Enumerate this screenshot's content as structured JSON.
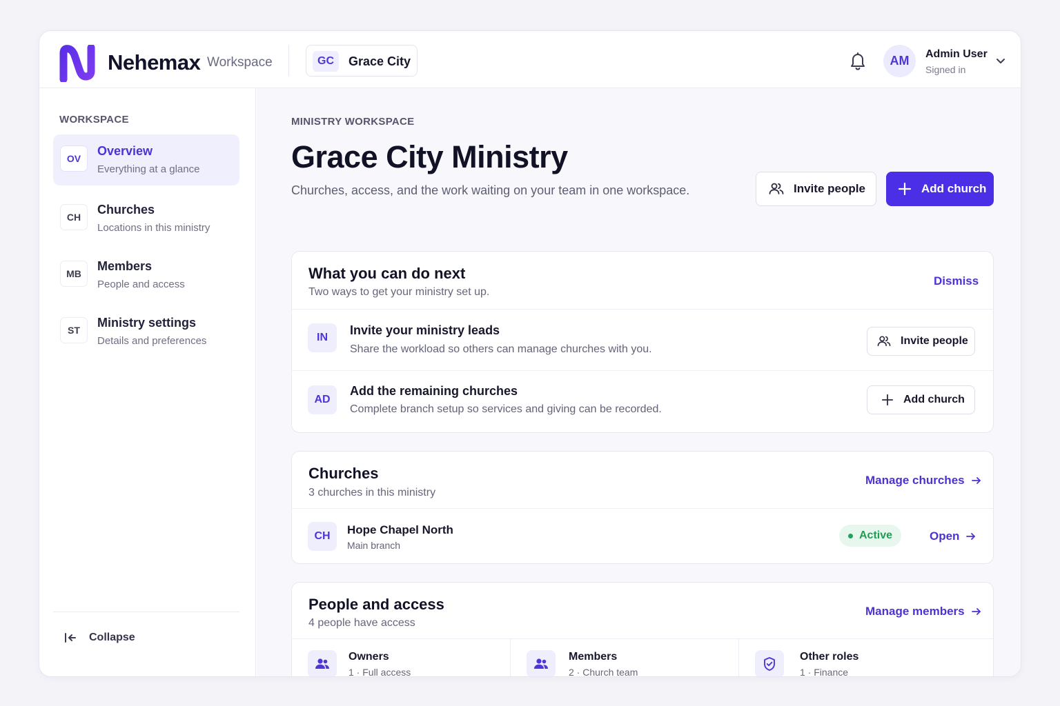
{
  "header": {
    "brand": "Nehemax",
    "brand_sub": "Workspace",
    "church_switcher": {
      "initials": "GC",
      "name": "Grace City"
    },
    "user": {
      "initials": "AM",
      "name": "Admin User",
      "status": "Signed in"
    }
  },
  "sidebar": {
    "heading": "WORKSPACE",
    "items": [
      {
        "code": "OV",
        "title": "Overview",
        "subtitle": "Everything at a glance",
        "active": true
      },
      {
        "code": "CH",
        "title": "Churches",
        "subtitle": "Locations in this ministry"
      },
      {
        "code": "MB",
        "title": "Members",
        "subtitle": "People and access"
      },
      {
        "code": "ST",
        "title": "Ministry settings",
        "subtitle": "Details and preferences"
      }
    ],
    "collapse_label": "Collapse"
  },
  "main": {
    "eyebrow": "MINISTRY WORKSPACE",
    "title": "Grace City Ministry",
    "subtitle": "Churches, access, and the work waiting on your team in one workspace.",
    "invite_label": "Invite people",
    "add_church_label": "Add church",
    "next_steps": {
      "title": "What you can do next",
      "subtitle": "Two ways to get your ministry set up.",
      "dismiss": "Dismiss",
      "items": [
        {
          "code": "IN",
          "title": "Invite your ministry leads",
          "subtitle": "Share the workload so others can manage churches with you.",
          "action": "Invite people"
        },
        {
          "code": "AD",
          "title": "Add the remaining churches",
          "subtitle": "Complete branch setup so services and giving can be recorded.",
          "action": "Add church"
        }
      ]
    },
    "churches": {
      "title": "Churches",
      "subtitle": "3 churches in this ministry",
      "manage": "Manage churches",
      "rows": [
        {
          "code": "CH",
          "name": "Hope Chapel North",
          "detail": "Main branch",
          "status": "Active",
          "open": "Open"
        }
      ]
    },
    "people": {
      "title": "People and access",
      "subtitle": "4 people have access",
      "manage": "Manage members",
      "groups": [
        {
          "title": "Owners",
          "detail": "1 · Full access",
          "icon": "users-icon"
        },
        {
          "title": "Members",
          "detail": "2 · Church team",
          "icon": "users-icon"
        },
        {
          "title": "Other roles",
          "detail": "1 · Finance",
          "icon": "shield-icon"
        }
      ]
    }
  },
  "colors": {
    "accent": "#4b2fe6",
    "active_green": "#1f9d55"
  }
}
